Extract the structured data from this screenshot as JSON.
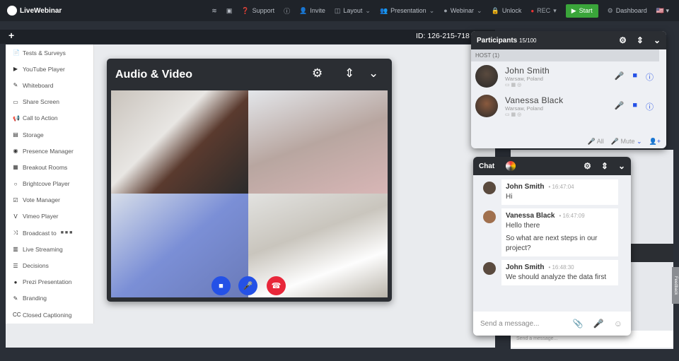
{
  "app": {
    "name": "LiveWebinar"
  },
  "nav": {
    "support": "Support",
    "invite": "Invite",
    "layout": "Layout",
    "presentation": "Presentation",
    "webinar": "Webinar",
    "unlock": "Unlock",
    "rec": "REC",
    "start": "Start",
    "dashboard": "Dashboard"
  },
  "session": {
    "id": "ID: 126-215-718"
  },
  "sidebar": {
    "items": [
      {
        "label": "Tests & Surveys",
        "icon": "📄"
      },
      {
        "label": "YouTube Player",
        "icon": "▶"
      },
      {
        "label": "Whiteboard",
        "icon": "✎"
      },
      {
        "label": "Share Screen",
        "icon": "▭"
      },
      {
        "label": "Call to Action",
        "icon": "📢"
      },
      {
        "label": "Storage",
        "icon": "▤"
      },
      {
        "label": "Presence Manager",
        "icon": "◉"
      },
      {
        "label": "Breakout Rooms",
        "icon": "▦"
      },
      {
        "label": "Brightcove Player",
        "icon": "○"
      },
      {
        "label": "Vote Manager",
        "icon": "☑"
      },
      {
        "label": "Vimeo Player",
        "icon": "V"
      },
      {
        "label": "Broadcast to",
        "icon": "⤨"
      },
      {
        "label": "Live Streaming",
        "icon": "▥"
      },
      {
        "label": "Decisions",
        "icon": "☰"
      },
      {
        "label": "Prezi Presentation",
        "icon": "●"
      },
      {
        "label": "Branding",
        "icon": "✎"
      },
      {
        "label": "Closed Captioning",
        "icon": "CC"
      }
    ]
  },
  "av": {
    "title": "Audio & Video"
  },
  "participants": {
    "title": "Participants",
    "count": "15/100",
    "host": "HOST (1)",
    "all": "All",
    "mute": "Mute",
    "list": [
      {
        "name": "John Smith",
        "location": "Warsaw, Poland"
      },
      {
        "name": "Vanessa Black",
        "location": "Warsaw, Poland"
      }
    ]
  },
  "chat": {
    "title": "Chat",
    "placeholder": "Send a message...",
    "messages": [
      {
        "name": "John Smith",
        "time": "16:47:04",
        "text": "Hi",
        "text2": ""
      },
      {
        "name": "Vanessa Black",
        "time": "16:47:09",
        "text": "Hello there",
        "text2": "So what are next steps in our project?"
      },
      {
        "name": "John Smith",
        "time": "16:48:30",
        "text": "We should analyze the data first",
        "text2": ""
      }
    ]
  },
  "background_chat": {
    "placeholder": "Send a message..."
  },
  "feedback": "Feedback",
  "colors": {
    "accent": "#2451e6",
    "start": "#3aa53a",
    "topbar": "#1f2329",
    "end_call": "#e8273a"
  }
}
